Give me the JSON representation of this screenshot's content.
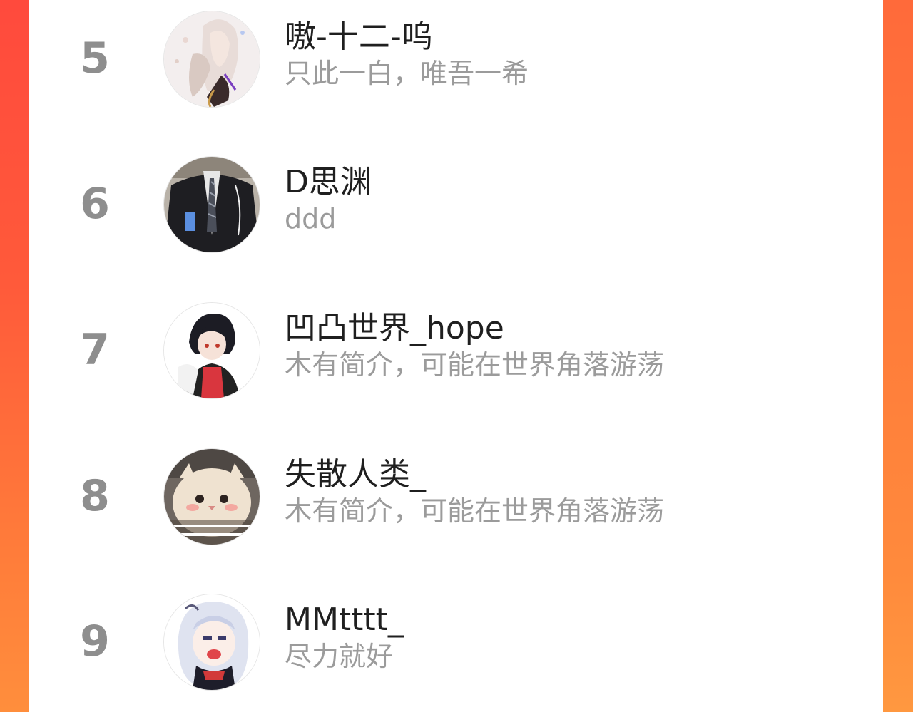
{
  "theme": {
    "accent_left": "#ff4a3d",
    "accent_right": "#ff9840",
    "card_background": "#ffffff",
    "rank_color": "#8e8e8e",
    "bio_color": "#9b9b9b",
    "name_color": "#1f1f1f"
  },
  "ranking": [
    {
      "rank": "5",
      "name": "嗷-十二-呜",
      "bio": "只此一白，唯吾一希",
      "avatar": "anime-white-hair-avatar"
    },
    {
      "rank": "6",
      "name": "D思渊",
      "bio": "ddd",
      "avatar": "school-uniform-photo-avatar"
    },
    {
      "rank": "7",
      "name": "凹凸世界_hope",
      "bio": "木有简介，可能在世界角落游荡",
      "avatar": "anime-boy-red-shirt-avatar"
    },
    {
      "rank": "8",
      "name": "失散人类_",
      "bio": "木有简介，可能在世界角落游荡",
      "avatar": "persian-cat-meme-avatar"
    },
    {
      "rank": "9",
      "name": "MMtttt_",
      "bio": "尽力就好",
      "avatar": "chibi-silver-hair-avatar"
    }
  ]
}
